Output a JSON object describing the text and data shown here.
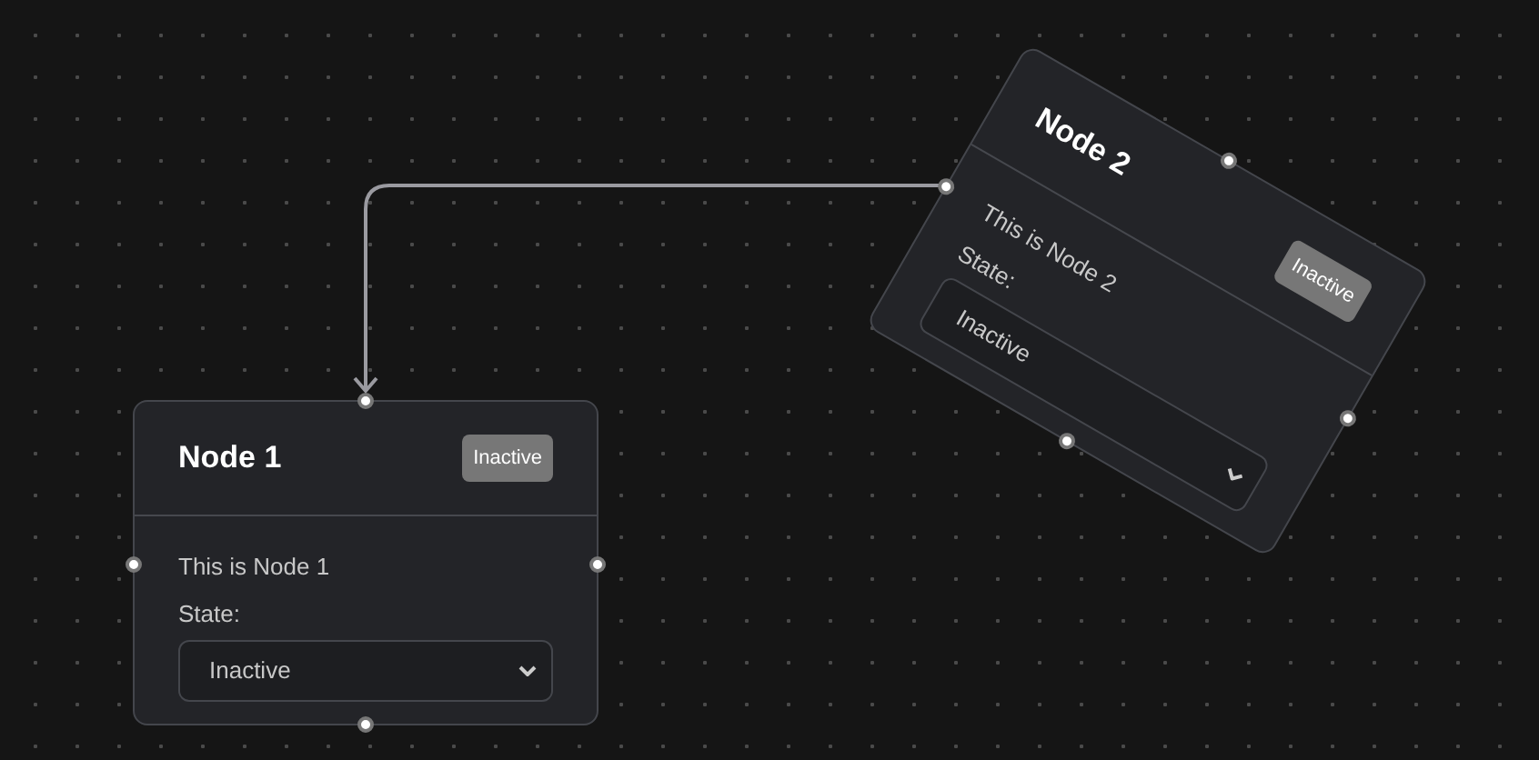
{
  "nodes": [
    {
      "title": "Node 1",
      "badge": "Inactive",
      "description": "This is Node 1",
      "state_label": "State:",
      "state_value": "Inactive"
    },
    {
      "title": "Node 2",
      "badge": "Inactive",
      "description": "This is Node 2",
      "state_label": "State:",
      "state_value": "Inactive"
    }
  ]
}
